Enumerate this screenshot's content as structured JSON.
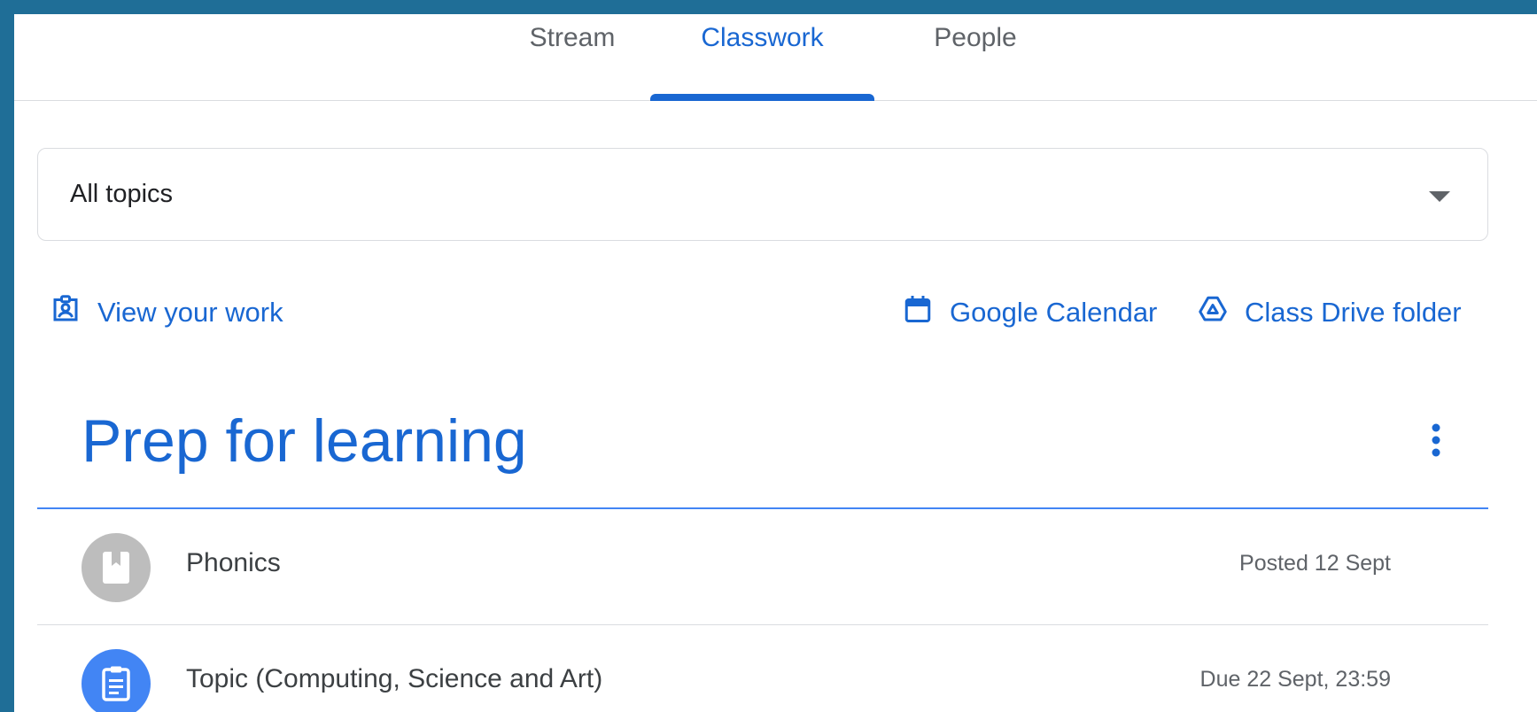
{
  "tabs": [
    {
      "label": "Stream",
      "active": false
    },
    {
      "label": "Classwork",
      "active": true
    },
    {
      "label": "People",
      "active": false
    }
  ],
  "topic_filter": {
    "selected": "All topics",
    "icon": "arrow-drop-down-icon"
  },
  "links": {
    "view_work": {
      "label": "View your work",
      "icon": "assignment-ind-icon"
    },
    "calendar": {
      "label": "Google Calendar",
      "icon": "calendar-icon"
    },
    "drive": {
      "label": "Class Drive folder",
      "icon": "drive-icon"
    }
  },
  "section": {
    "title": "Prep for learning",
    "menu_icon": "more-vert-icon",
    "items": [
      {
        "title": "Phonics",
        "meta": "Posted 12 Sept",
        "icon": "material-icon",
        "icon_bg": "#bdbdbd"
      },
      {
        "title": "Topic (Computing, Science and Art)",
        "meta": "Due 22 Sept, 23:59",
        "icon": "assignment-icon",
        "icon_bg": "#4285f4"
      }
    ]
  },
  "colors": {
    "accent": "#1967d2",
    "frame": "#1f6e97"
  }
}
